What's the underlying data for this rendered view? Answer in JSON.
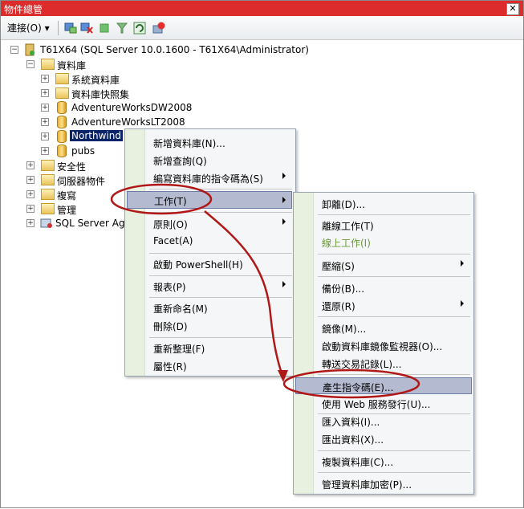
{
  "window": {
    "title": "物件總管",
    "close_symbol": "✕"
  },
  "toolbar": {
    "connect_label": "連接(O)"
  },
  "tree": {
    "server": "T61X64 (SQL Server 10.0.1600 - T61X64\\Administrator)",
    "databases": "資料庫",
    "system_db": "系統資料庫",
    "snapshots": "資料庫快照集",
    "db1": "AdventureWorksDW2008",
    "db2": "AdventureWorksLT2008",
    "db3": "Northwind",
    "db4": "pubs",
    "security": "安全性",
    "server_objects": "伺服器物件",
    "replication": "複寫",
    "management": "管理",
    "agent": "SQL Server Age"
  },
  "context_menu": {
    "new_db": "新增資料庫(N)...",
    "new_query": "新增查詢(Q)",
    "script_db": "編寫資料庫的指令碼為(S)",
    "tasks": "工作(T)",
    "policies": "原則(O)",
    "facets": "Facet(A)",
    "powershell": "啟動 PowerShell(H)",
    "reports": "報表(P)",
    "rename": "重新命名(M)",
    "delete": "刪除(D)",
    "refresh": "重新整理(F)",
    "properties": "屬性(R)"
  },
  "tasks_menu": {
    "detach": "卸離(D)...",
    "offline": "離線工作(T)",
    "online": "線上工作(I)",
    "shrink": "壓縮(S)",
    "backup": "備份(B)...",
    "restore": "還原(R)",
    "mirror": "鏡像(M)...",
    "mirror_monitor": "啟動資料庫鏡像監視器(O)...",
    "log_shipping": "轉送交易記錄(L)...",
    "gen_scripts": "產生指令碼(E)...",
    "publish_web": "使用 Web 服務發行(U)...",
    "import": "匯入資料(I)...",
    "export": "匯出資料(X)...",
    "copy_db": "複製資料庫(C)...",
    "manage_encryption": "管理資料庫加密(P)..."
  },
  "colors": {
    "titlebar": "#dc2c2c",
    "highlight": "#b4bbd1",
    "annotation": "#b01818"
  }
}
